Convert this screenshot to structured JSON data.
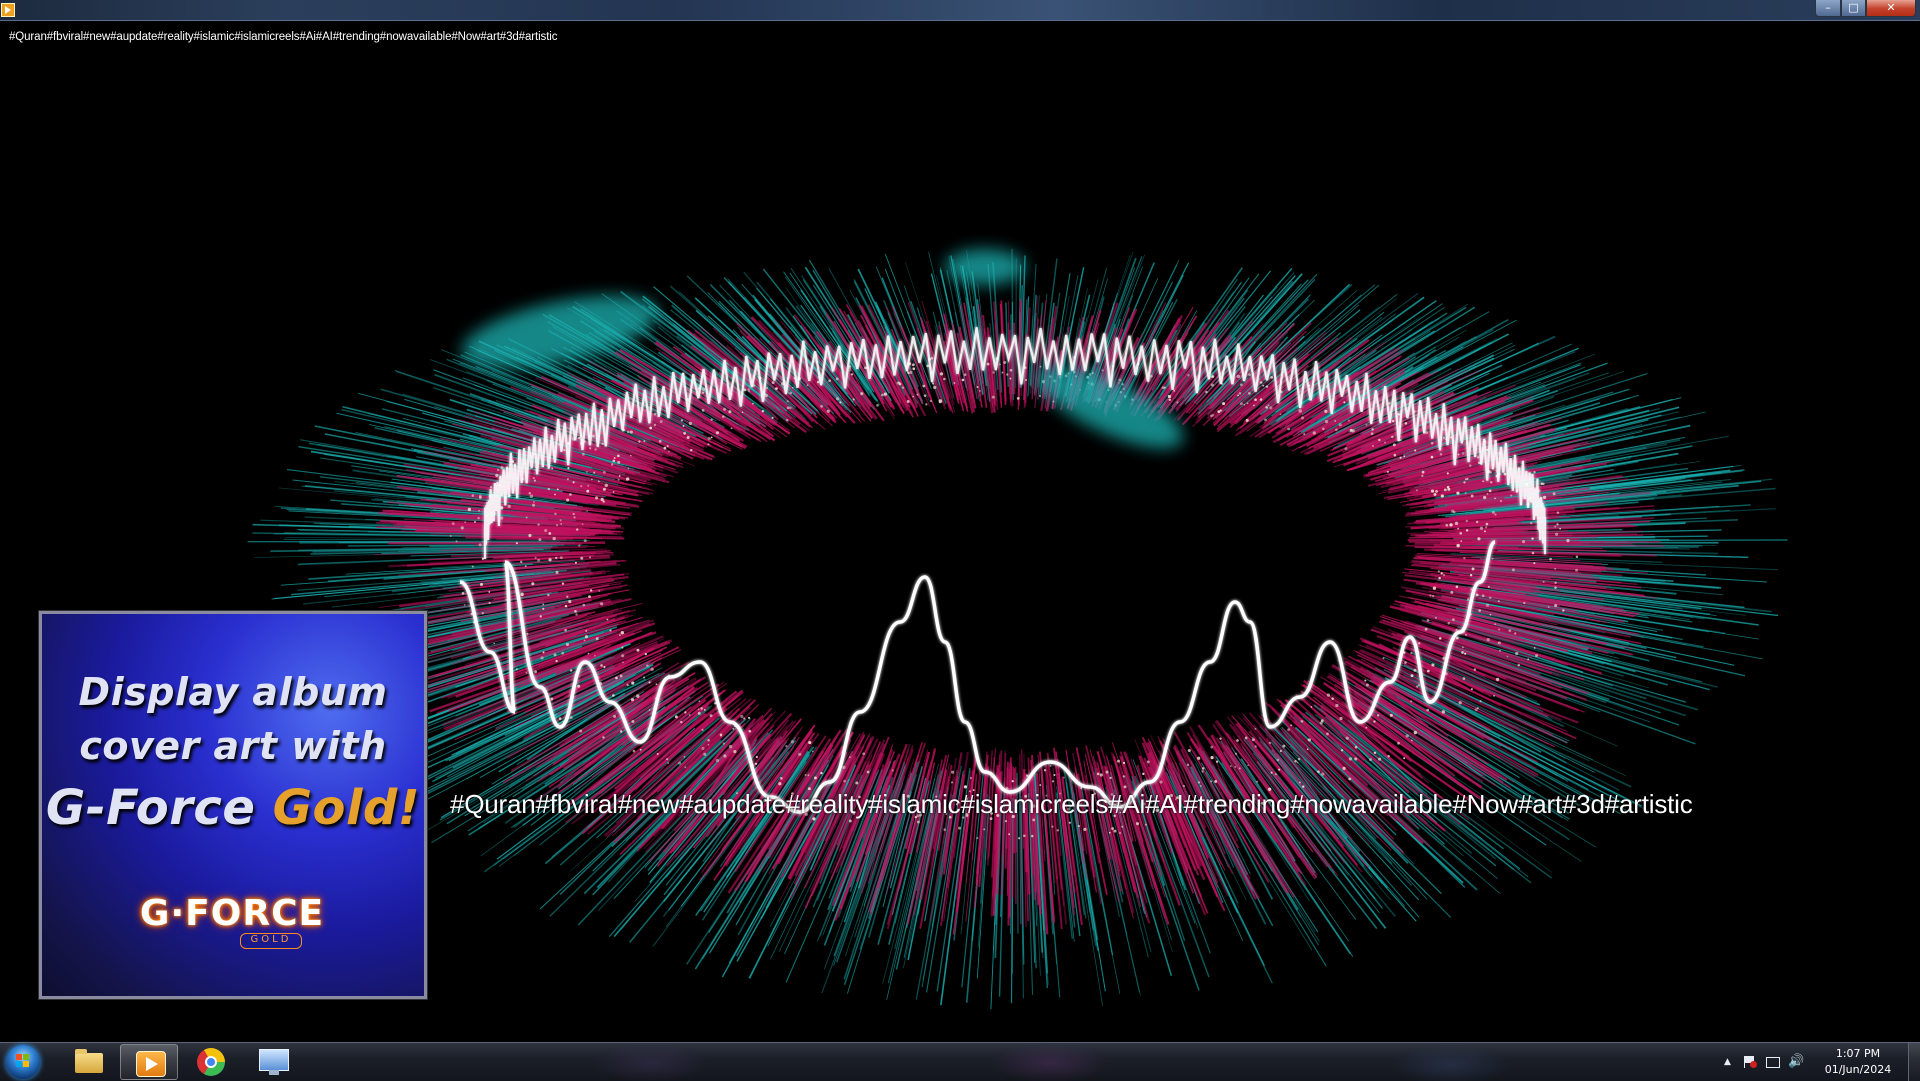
{
  "window": {
    "title": "#Quran#fbviral#new#aupdate#reality#islamic#islamicreels#Ai#AI#trending#nowavailable#Now#art#3d#artistic",
    "minimize_glyph": "–",
    "maximize_glyph": "□",
    "close_glyph": "✕"
  },
  "visualizer": {
    "caption": "#Quran#fbviral#new#aupdate#reality#islamic#islamicreels#Ai#AI#trending#nowavailable#Now#art#3d#artistic",
    "colors": {
      "magenta": "#c2125f",
      "cyan": "#1ab4b4",
      "white": "#ffffff",
      "sparkle": "#e8d8c8"
    }
  },
  "album_promo": {
    "line1": "Display album",
    "line2": "cover art with",
    "line3_prefix": "G-Force ",
    "line3_gold": "Gold!",
    "logo_text": "G·FORCE",
    "logo_sub": "GOLD"
  },
  "taskbar": {
    "apps": [
      {
        "name": "Windows Explorer",
        "icon": "folder-icon"
      },
      {
        "name": "Media Player",
        "icon": "player-icon",
        "active": true
      },
      {
        "name": "Google Chrome",
        "icon": "chrome-icon"
      },
      {
        "name": "Network",
        "icon": "network-icon"
      }
    ],
    "tray": {
      "overflow_glyph": "▲",
      "volume_glyph": "🔊"
    },
    "clock": {
      "time": "1:07 PM",
      "date": "01/Jun/2024"
    }
  }
}
